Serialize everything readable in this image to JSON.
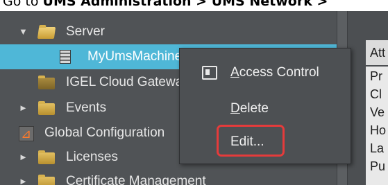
{
  "instruction": {
    "prefix": "Go to ",
    "path": "UMS Administration > UMS Network >"
  },
  "tree": {
    "top_partial_label": "UMS Network",
    "items": [
      {
        "label": "Server",
        "icon": "folder-open-icon",
        "expanded": true
      },
      {
        "label": "MyUmsMachine",
        "icon": "server-icon",
        "selected": true
      },
      {
        "label": "IGEL Cloud Gateway",
        "icon": "folder-icon"
      },
      {
        "label": "Events",
        "icon": "folder-icon",
        "collapsed": true
      },
      {
        "label": "Global Configuration",
        "icon": "global-configuration-icon"
      },
      {
        "label": "Licenses",
        "icon": "folder-icon",
        "collapsed": true
      },
      {
        "label": "Certificate Management",
        "icon": "folder-icon",
        "collapsed": true
      }
    ]
  },
  "right_panel": {
    "header": "Att",
    "cells": [
      "Pr",
      "Cl",
      "Ve",
      "Ho",
      "La",
      "Pu"
    ]
  },
  "context_menu": {
    "items": [
      {
        "label": "Access Control",
        "mnemonic": "A",
        "icon": "access-control-icon"
      },
      {
        "label": "Delete",
        "mnemonic": "D"
      },
      {
        "label": "Edit...",
        "highlighted": true
      }
    ]
  },
  "colors": {
    "background": "#505356",
    "selection": "#4fb7d7",
    "highlight_border": "#e53b3b"
  }
}
